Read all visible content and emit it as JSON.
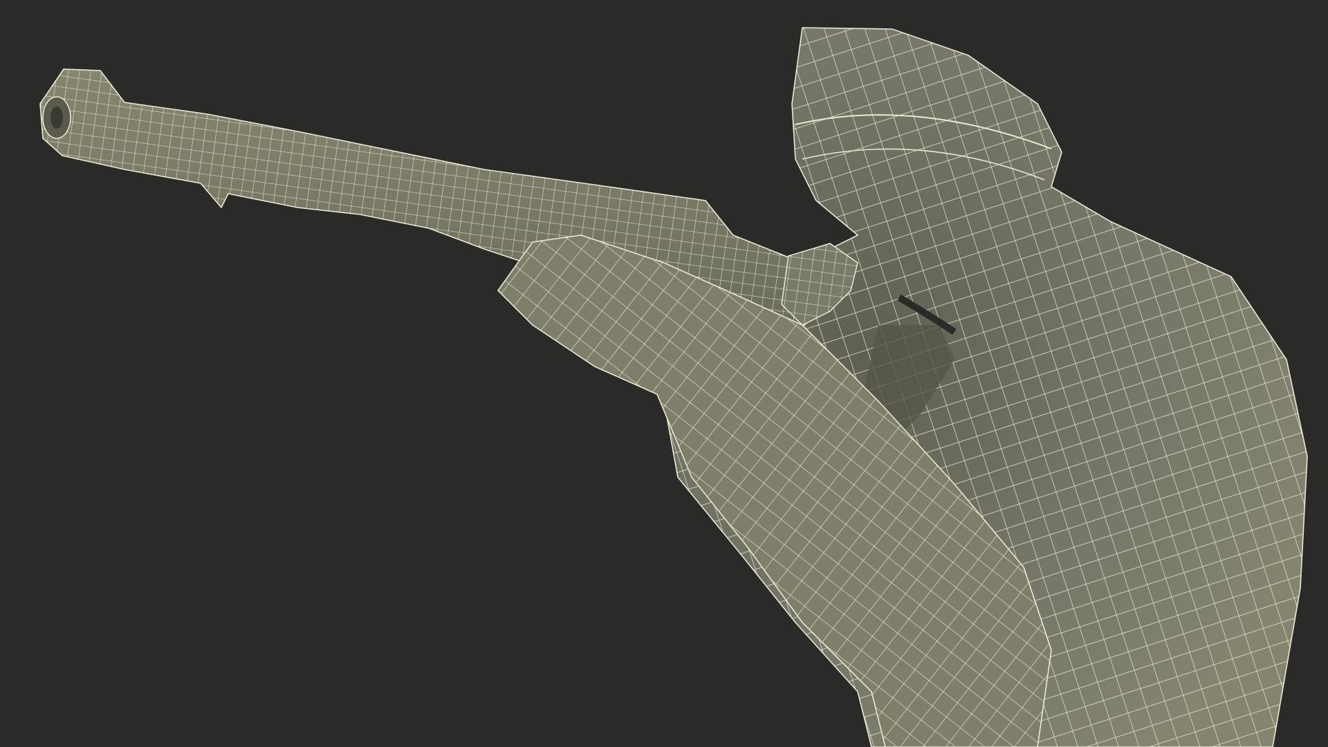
{
  "scene": {
    "background_color": "#2a2a28",
    "mesh_fill_color": "#7a7a68",
    "mesh_shade_color": "#5f5f52",
    "wire_color": "#ece9d6",
    "subject": "wireframe-mesh-figure-aiming-rifle"
  }
}
